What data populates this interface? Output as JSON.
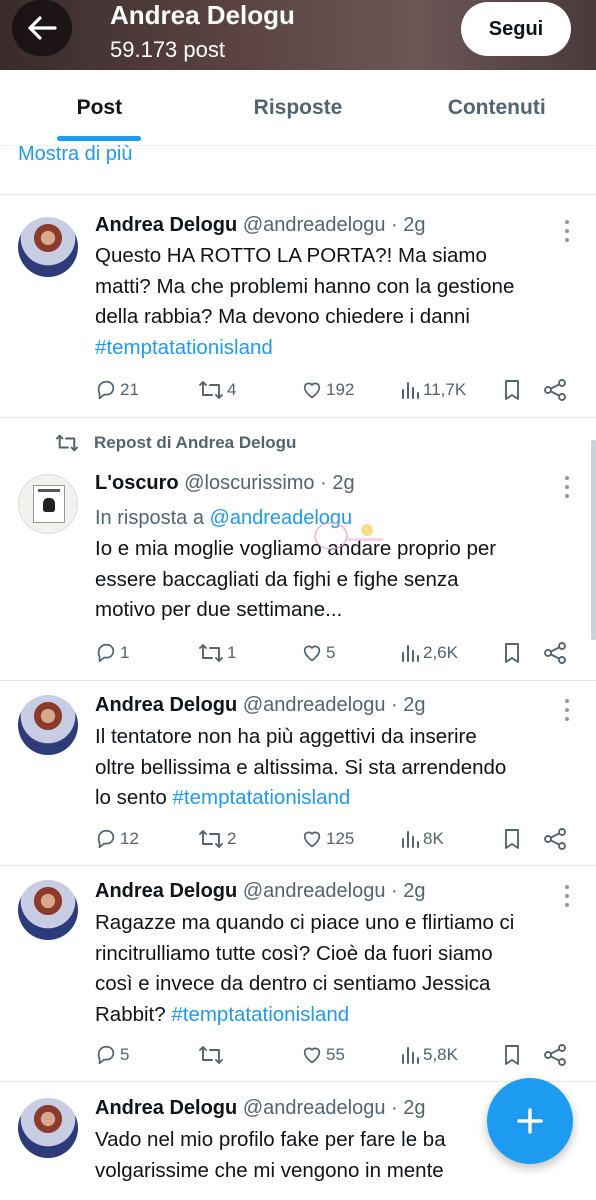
{
  "header": {
    "name": "Andrea Delogu",
    "post_count": "59.173 post",
    "follow_label": "Segui"
  },
  "tabs": [
    {
      "label": "Post",
      "active": true
    },
    {
      "label": "Risposte",
      "active": false
    },
    {
      "label": "Contenuti",
      "active": false
    }
  ],
  "show_more": "Mostra di più",
  "tweets": [
    {
      "name": "Andrea Delogu",
      "handle": "@andreadelogu · 2g",
      "lines": [
        "Questo HA ROTTO LA PORTA?! Ma siamo",
        "matti? Ma che problemi hanno con la gestione",
        "della rabbia? Ma devono chiedere i danni"
      ],
      "hashtag": "#temptatationisland",
      "replies": "21",
      "reposts": "4",
      "likes": "192",
      "views": "11,7K"
    },
    {
      "repost_label": "Repost di Andrea Delogu",
      "name": "L'oscuro",
      "handle": "@loscurissimo · 2g",
      "reply_prefix": "In risposta a ",
      "reply_handle": "@andreadelogu",
      "lines": [
        "Io e mia moglie vogliamo andare proprio per",
        "essere baccagliati da fighi e fighe senza",
        "motivo per due settimane..."
      ],
      "replies": "1",
      "reposts": "1",
      "likes": "5",
      "views": "2,6K"
    },
    {
      "name": "Andrea Delogu",
      "handle": "@andreadelogu · 2g",
      "lines": [
        "Il tentatore non ha più aggettivi da inserire",
        "oltre bellissima e altissima. Si sta arrendendo"
      ],
      "last_line_prefix": "lo sento ",
      "hashtag": "#temptatationisland",
      "replies": "12",
      "reposts": "2",
      "likes": "125",
      "views": "8K"
    },
    {
      "name": "Andrea Delogu",
      "handle": "@andreadelogu · 2g",
      "lines": [
        "Ragazze ma quando ci piace uno e flirtiamo ci",
        "rincitrulliamo tutte così? Cioè da fuori siamo",
        "così e invece da dentro ci sentiamo Jessica"
      ],
      "last_line_prefix": "Rabbit? ",
      "hashtag": "#temptatationisland",
      "replies": "5",
      "reposts": "",
      "likes": "55",
      "views": "5,8K"
    },
    {
      "name": "Andrea Delogu",
      "handle": "@andreadelogu · 2g",
      "lines": [
        "Vado nel mio profilo fake per fare le ba",
        "volgarissime che mi vengono in mente"
      ]
    }
  ],
  "colors": {
    "accent": "#1d9bf0",
    "text": "#0f1419",
    "muted": "#536471"
  },
  "icons": [
    "back-arrow-icon",
    "reply-icon",
    "repost-icon",
    "like-icon",
    "views-icon",
    "bookmark-icon",
    "share-icon",
    "compose-plus-icon"
  ]
}
